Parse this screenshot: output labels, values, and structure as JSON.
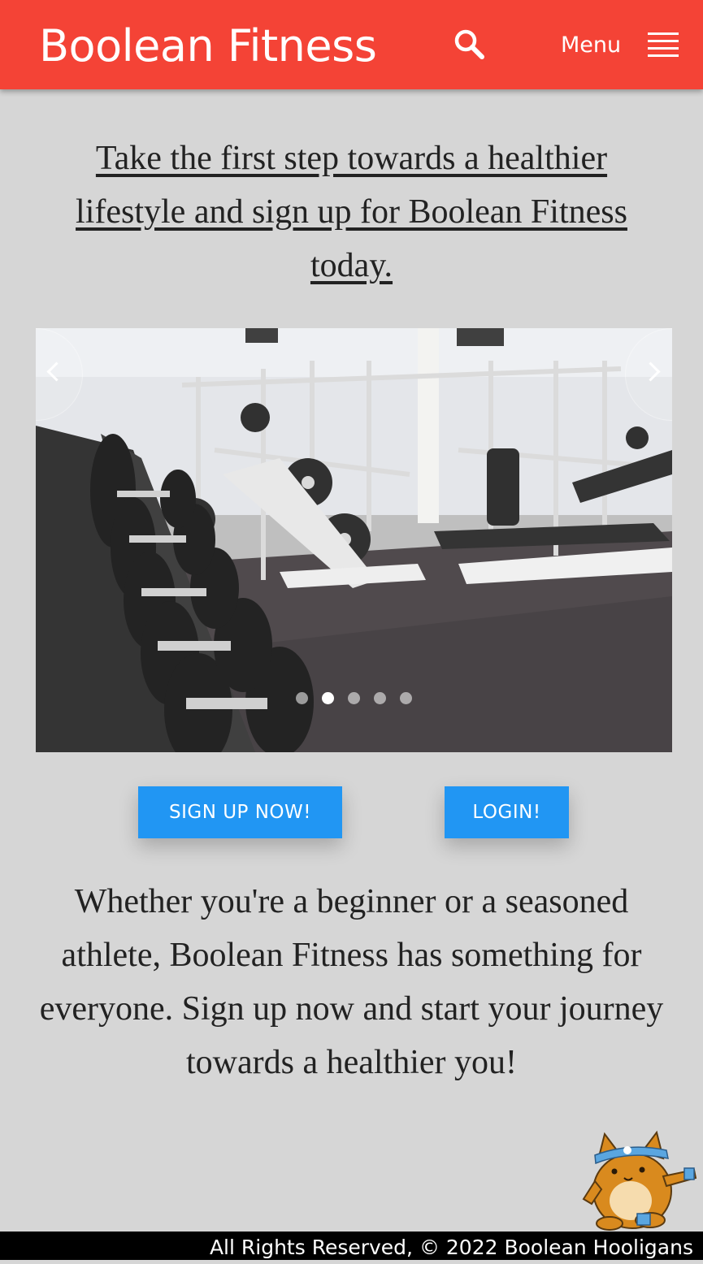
{
  "header": {
    "brand": "Boolean Fitness",
    "menu_label": "Menu",
    "search_icon": "search-icon",
    "menu_icon": "hamburger-menu-icon",
    "background_color": "#f44336"
  },
  "intro": {
    "headline": "Take the first step towards a healthier lifestyle and sign up for Boolean Fitness today."
  },
  "carousel": {
    "image": "gym-dumbbell-rack-photo",
    "prev_icon": "chevron-left-icon",
    "next_icon": "chevron-right-icon",
    "slide_count": 5,
    "active_slide": 2
  },
  "actions": {
    "signup_label": "SIGN UP NOW!",
    "login_label": "LOGIN!",
    "button_color": "#2196f3"
  },
  "blurb": {
    "text": "Whether you're a beginner or a seasoned athlete, Boolean Fitness has something for everyone. Sign up now and start your journey towards a healthier you!"
  },
  "mascot": {
    "icon": "cat-mascot-icon"
  },
  "footer": {
    "text": "All Rights Reserved, © 2022 Boolean Hooligans"
  }
}
